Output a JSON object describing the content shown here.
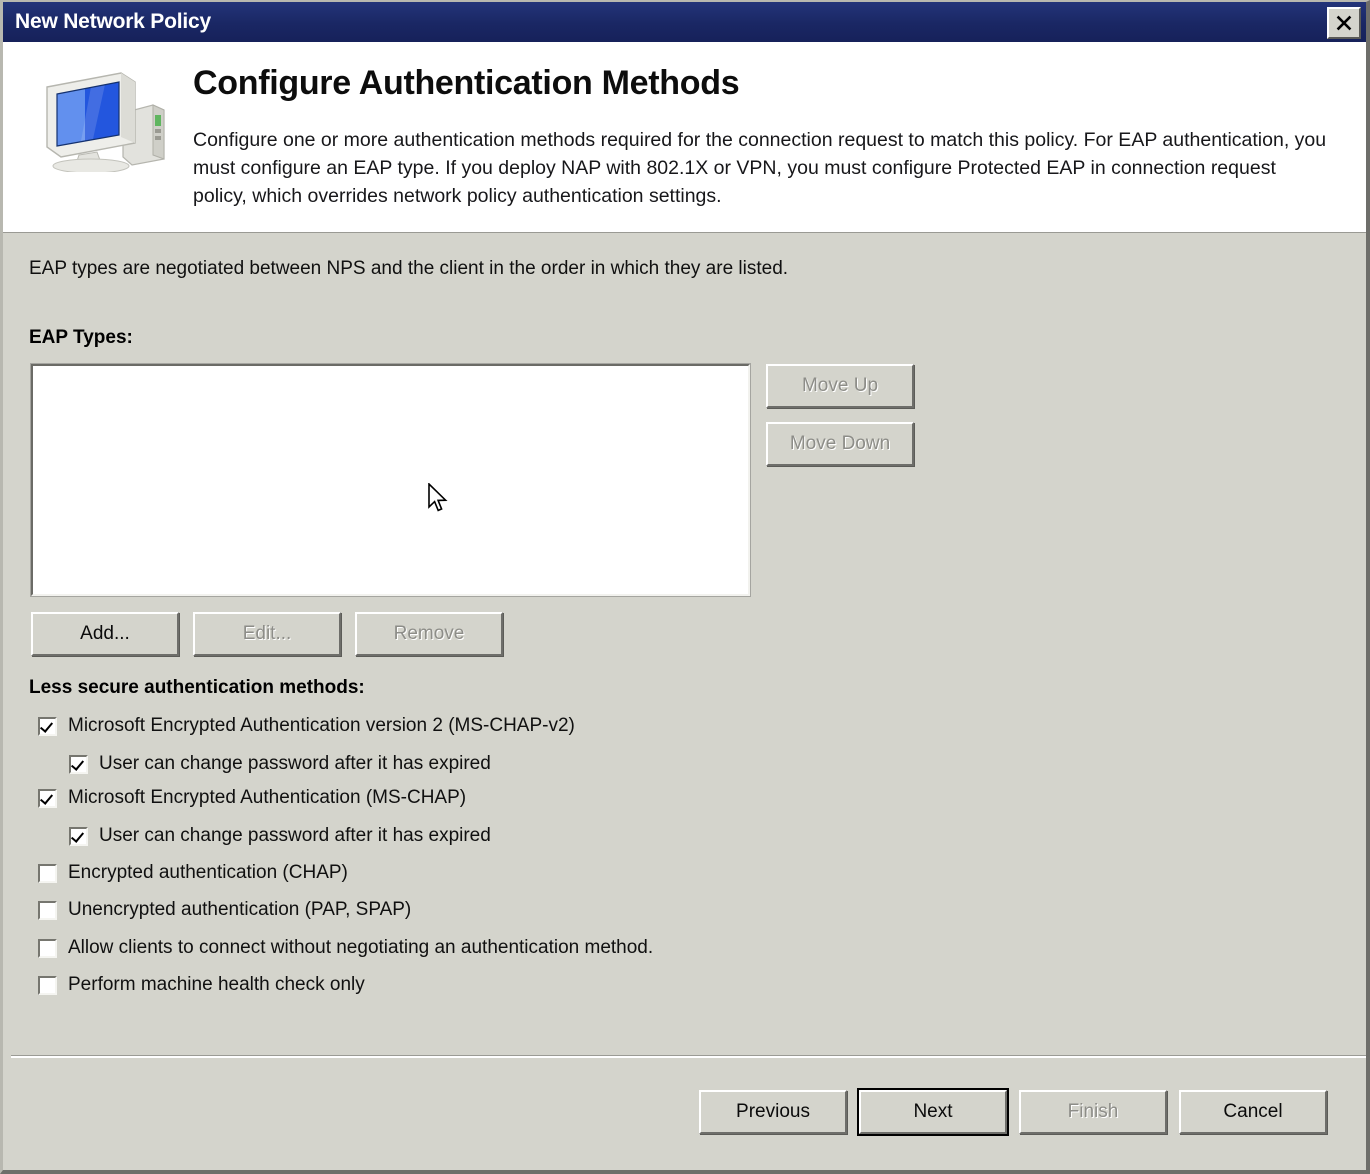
{
  "window": {
    "title": "New Network Policy",
    "close_icon": "close-x-icon"
  },
  "header": {
    "icon": "computer-monitor-icon",
    "title": "Configure Authentication Methods",
    "description": "Configure one or more authentication methods required for the connection request to match this policy. For EAP authentication, you must configure an EAP type. If you deploy NAP with 802.1X or VPN, you must configure Protected EAP in connection request policy, which overrides network policy authentication settings."
  },
  "main": {
    "intro_text": "EAP types are negotiated between NPS and the client in the order in which they are listed.",
    "eap_types_label": "EAP Types:",
    "eap_types_items": [],
    "move_up_label": "Move Up",
    "move_down_label": "Move Down",
    "add_label": "Add...",
    "edit_label": "Edit...",
    "remove_label": "Remove",
    "less_secure_label": "Less secure authentication methods:",
    "checkboxes": [
      {
        "label": "Microsoft Encrypted Authentication version 2 (MS-CHAP-v2)",
        "checked": true,
        "indent": 0
      },
      {
        "label": "User can change password after it has expired",
        "checked": true,
        "indent": 1
      },
      {
        "label": "Microsoft Encrypted Authentication (MS-CHAP)",
        "checked": true,
        "indent": 0
      },
      {
        "label": "User can change password after it has expired",
        "checked": true,
        "indent": 1
      },
      {
        "label": "Encrypted authentication (CHAP)",
        "checked": false,
        "indent": 0
      },
      {
        "label": "Unencrypted authentication (PAP, SPAP)",
        "checked": false,
        "indent": 0
      },
      {
        "label": "Allow clients to connect without negotiating an authentication method.",
        "checked": false,
        "indent": 0
      },
      {
        "label": "Perform machine health check only",
        "checked": false,
        "indent": 0
      }
    ]
  },
  "footer": {
    "previous_label": "Previous",
    "next_label": "Next",
    "finish_label": "Finish",
    "cancel_label": "Cancel"
  },
  "colors": {
    "titlebar": "#1a2764",
    "dialog_face": "#d4d4cc",
    "header_bg": "#ffffff",
    "text": "#101010",
    "disabled_text": "#8d8d88"
  },
  "cursor": {
    "icon": "arrow-pointer-cursor"
  }
}
